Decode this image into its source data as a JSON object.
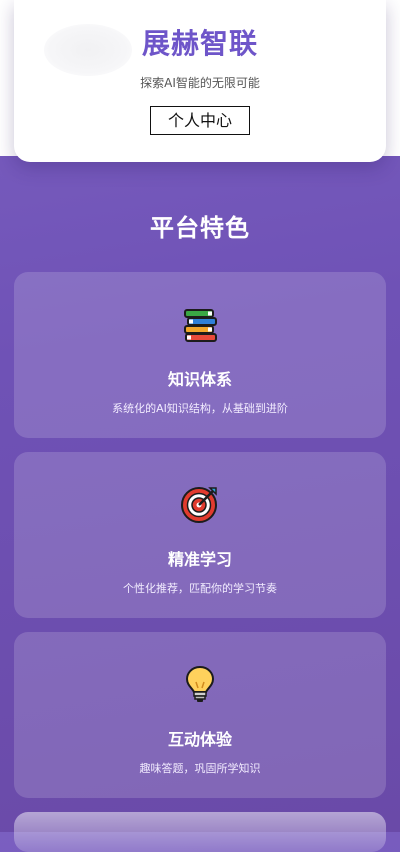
{
  "header": {
    "brand_title": "展赫智联",
    "brand_subtitle": "探索AI智能的无限可能",
    "profile_button_label": "个人中心"
  },
  "features": {
    "section_title": "平台特色",
    "items": [
      {
        "icon": "books-icon",
        "title": "知识体系",
        "description": "系统化的AI知识结构，从基础到进阶"
      },
      {
        "icon": "target-icon",
        "title": "精准学习",
        "description": "个性化推荐，匹配你的学习节奏"
      },
      {
        "icon": "lightbulb-icon",
        "title": "互动体验",
        "description": "趣味答题，巩固所学知识"
      }
    ]
  },
  "colors": {
    "brand_accent": "#6e55c9",
    "background_top": "#7a5fc0",
    "background_bottom": "#6a4aa8",
    "card_text": "#ffffff"
  }
}
